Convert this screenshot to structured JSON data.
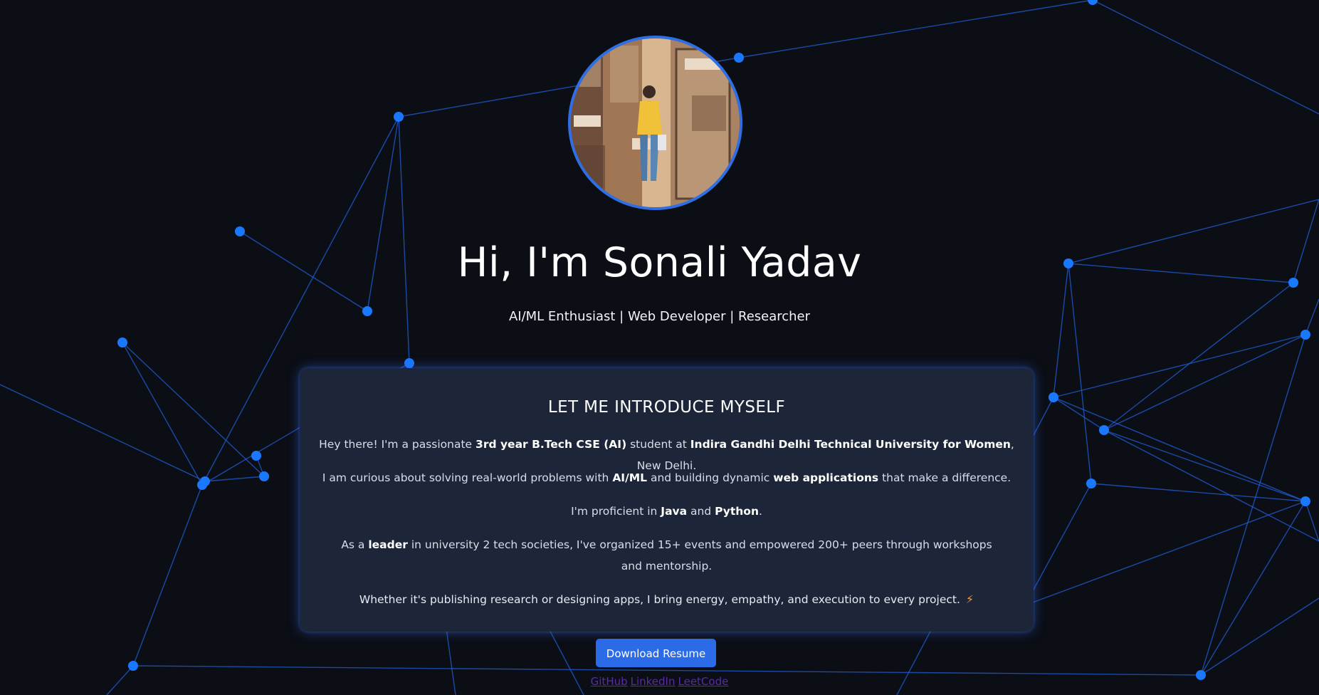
{
  "header": {
    "greeting": "Hi, I'm Sonali Yadav",
    "tagline": "AI/ML Enthusiast | Web Developer | Researcher"
  },
  "profile": {
    "avatar_icon": "profile-photo"
  },
  "intro": {
    "heading": "LET ME INTRODUCE MYSELF",
    "p1": {
      "a": "Hey there! I'm a passionate ",
      "b": "3rd year B.Tech CSE (AI)",
      "c": " student at ",
      "d": "Indira Gandhi Delhi Technical University for Women",
      "e": ", New Delhi."
    },
    "p2": {
      "a": "I am curious about solving real-world problems with ",
      "b": "AI/ML",
      "c": " and building dynamic ",
      "d": "web applications",
      "e": " that make a difference."
    },
    "p3": {
      "a": "I'm proficient in ",
      "b": "Java",
      "c": " and ",
      "d": "Python",
      "e": "."
    },
    "p4": {
      "a": "As a ",
      "b": "leader",
      "c": " in university 2 tech societies, I've organized 15+ events and empowered 200+ peers through workshops and mentorship."
    },
    "p5": {
      "a": "Whether it's publishing research or designing apps, I bring energy, empathy, and execution to every project.",
      "icon": "lightning-bolt-icon"
    }
  },
  "actions": {
    "resume_label": "Download Resume"
  },
  "links": {
    "github": "GitHub",
    "linkedin": "LinkedIn",
    "leetcode": "LeetCode"
  },
  "colors": {
    "background": "#0c0e16",
    "card": "#1d2639",
    "accent": "#2c6be8",
    "node": "#1a78ff",
    "link_visited": "#5b2aa5"
  }
}
